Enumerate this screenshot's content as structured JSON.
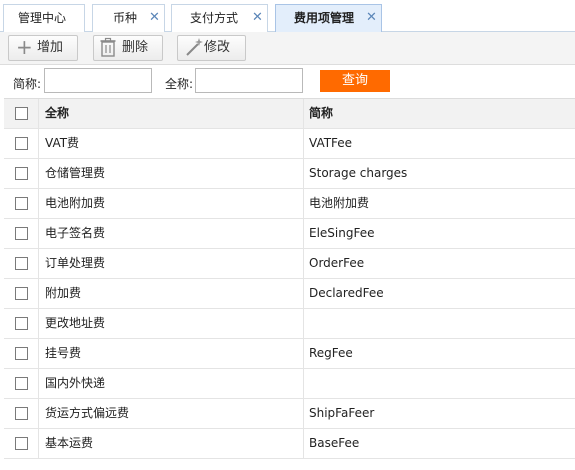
{
  "tabs": [
    {
      "label": "管理中心",
      "closable": false,
      "active": false
    },
    {
      "label": "币种",
      "closable": true,
      "active": false
    },
    {
      "label": "支付方式",
      "closable": true,
      "active": false
    },
    {
      "label": "费用项管理",
      "closable": true,
      "active": true
    }
  ],
  "tab_close_glyph": "✕",
  "toolbar": {
    "add": {
      "label": "增加",
      "icon": "plus-icon"
    },
    "delete": {
      "label": "删除",
      "icon": "trash-icon"
    },
    "edit": {
      "label": "修改",
      "icon": "edit-wand-icon"
    }
  },
  "search": {
    "short_name_label": "简称:",
    "short_name_value": "",
    "full_name_label": "全称:",
    "full_name_value": "",
    "query_label": "查询"
  },
  "table": {
    "columns": [
      "全称",
      "简称"
    ],
    "rows": [
      {
        "full": "VAT费",
        "short": "VATFee"
      },
      {
        "full": "仓储管理费",
        "short": "Storage charges"
      },
      {
        "full": "电池附加费",
        "short": "电池附加费"
      },
      {
        "full": "电子签名费",
        "short": "EleSingFee"
      },
      {
        "full": "订单处理费",
        "short": "OrderFee"
      },
      {
        "full": "附加费",
        "short": "DeclaredFee"
      },
      {
        "full": "更改地址费",
        "short": ""
      },
      {
        "full": "挂号费",
        "short": "RegFee"
      },
      {
        "full": "国内外快递",
        "short": ""
      },
      {
        "full": "货运方式偏远费",
        "short": "ShipFaFeer"
      },
      {
        "full": "基本运费",
        "short": "BaseFee"
      }
    ]
  },
  "colors": {
    "accent": "#ff6a00",
    "active_tab": "#e3eefb",
    "tab_border": "#c7d6e6"
  }
}
